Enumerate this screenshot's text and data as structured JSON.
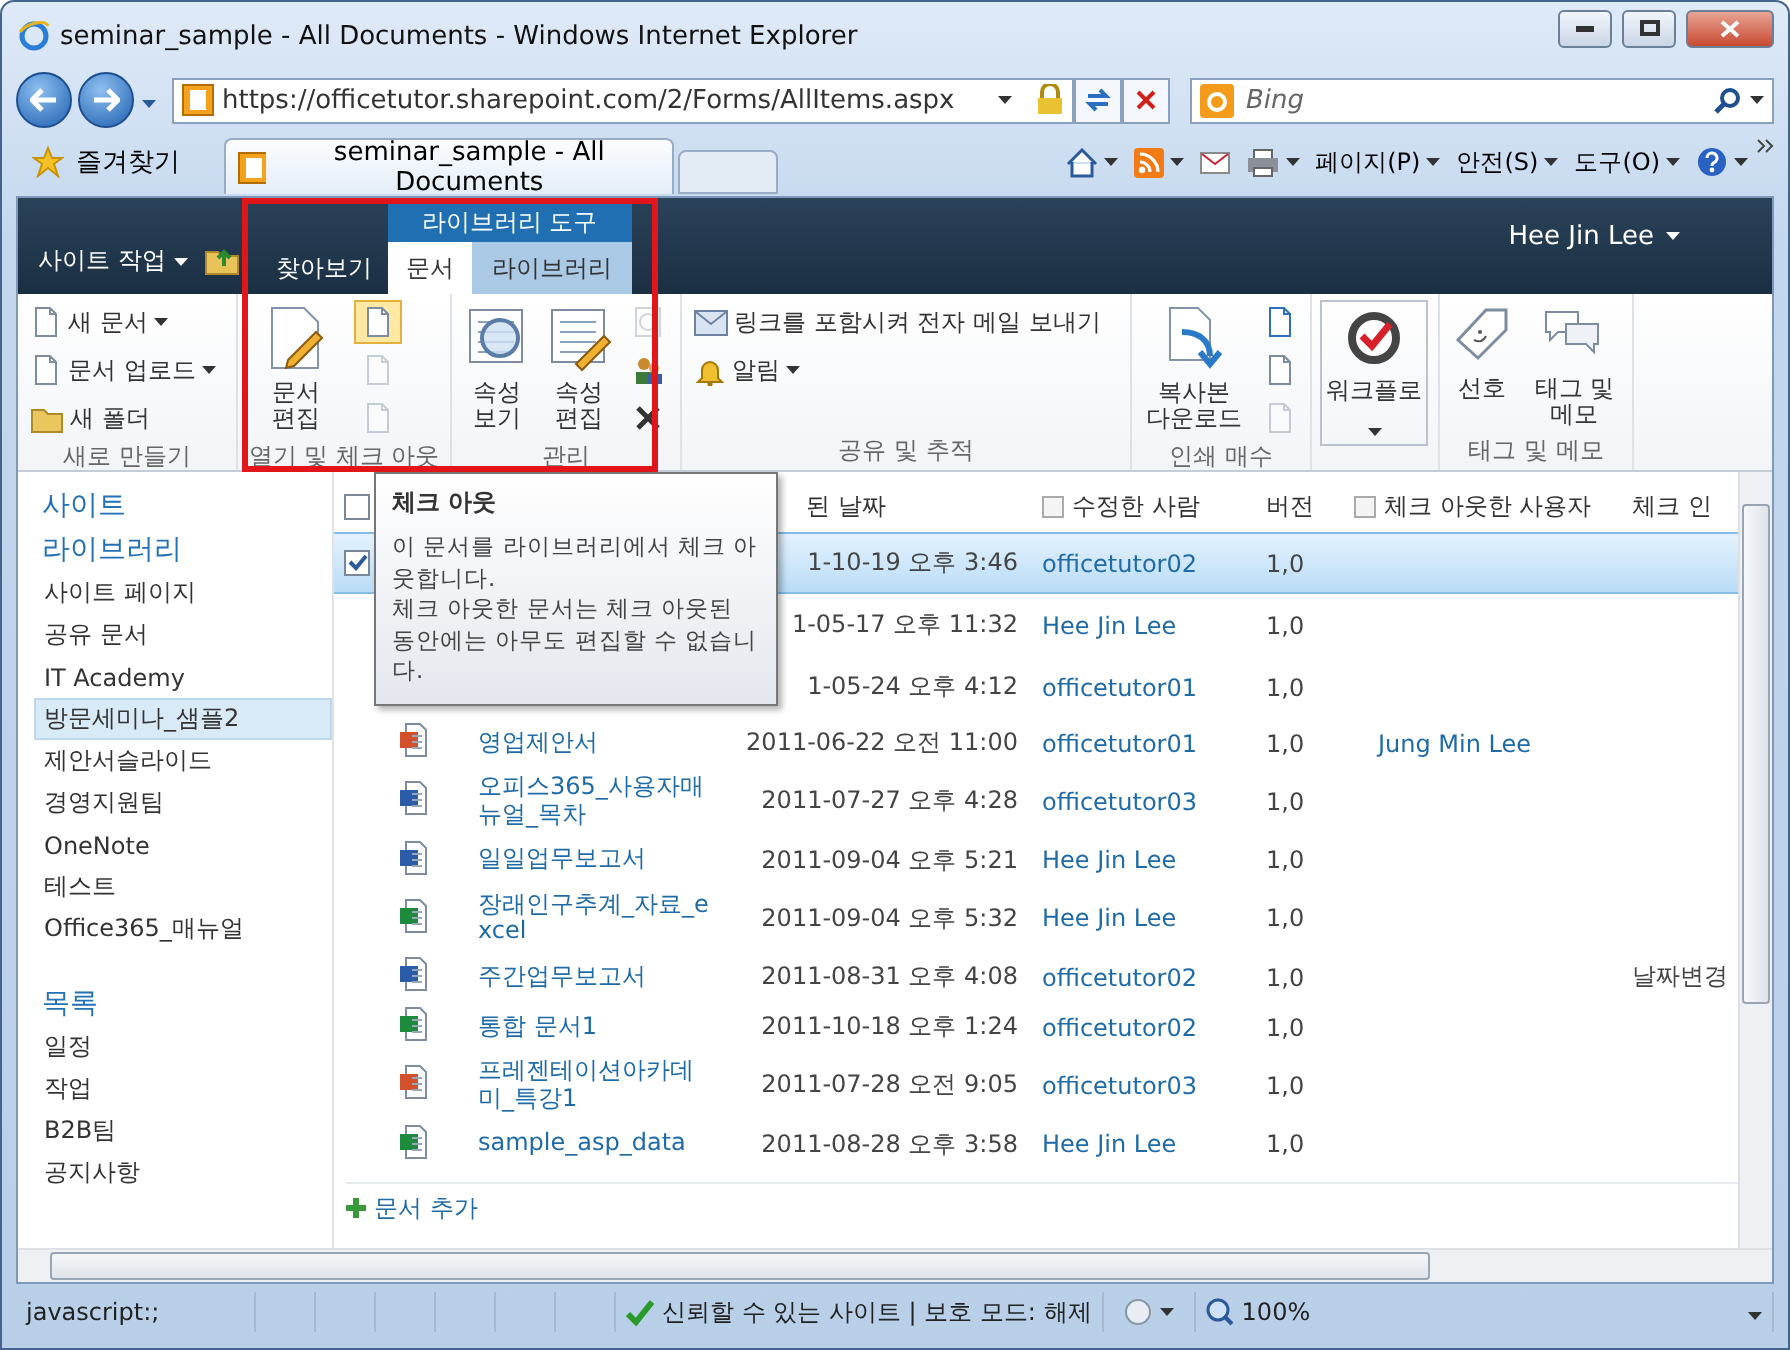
{
  "window": {
    "title": "seminar_sample - All Documents - Windows Internet Explorer"
  },
  "address_bar": {
    "url": "https://officetutor.sharepoint.com/2/Forms/AllItems.aspx"
  },
  "search": {
    "placeholder": "Bing"
  },
  "favorites_button": "즐겨찾기",
  "browser_tabs": [
    {
      "label": "seminar_sample - All Documents",
      "selected": true
    }
  ],
  "command_menus": [
    "페이지(P)",
    "안전(S)",
    "도구(O)"
  ],
  "site_header": {
    "site_actions": "사이트 작업",
    "context_group": "라이브러리 도구",
    "user": "Hee Jin Lee",
    "tabs": [
      {
        "label": "찾아보기",
        "selected": false
      },
      {
        "label": "문서",
        "selected": true
      },
      {
        "label": "라이브러리",
        "selected": false
      }
    ]
  },
  "ribbon": {
    "new": {
      "label": "새로 만들기",
      "buttons": [
        {
          "label": "새 문서",
          "dropdown": true
        },
        {
          "label": "문서 업로드",
          "dropdown": true
        },
        {
          "label": "새 폴더",
          "dropdown": false
        }
      ]
    },
    "open": {
      "label": "열기 및 체크 아웃",
      "edit": "문서 편집",
      "tools": [
        {
          "hovered": true,
          "disabled": false
        },
        {
          "hovered": false,
          "disabled": true
        },
        {
          "hovered": false,
          "disabled": true
        }
      ]
    },
    "manage": {
      "label": "관리",
      "buttons": [
        "속성 보기",
        "속성 편집"
      ],
      "tools": [
        {
          "disabled": true
        },
        {
          "disabled": false
        },
        {
          "disabled": false
        }
      ]
    },
    "share": {
      "label": "공유 및 추적",
      "buttons": [
        {
          "label": "링크를 포함시켜 전자 메일 보내기",
          "dropdown": false
        },
        {
          "label": "알림",
          "dropdown": true
        }
      ]
    },
    "copies": {
      "label": "인쇄 매수",
      "download": "복사본 다운로드",
      "tools": [
        {
          "disabled": false
        },
        {
          "disabled": false
        },
        {
          "disabled": true
        }
      ]
    },
    "workflow": {
      "button": "워크플로"
    },
    "tags": {
      "label": "태그 및 메모",
      "buttons": [
        "선호",
        "태그 및 메모"
      ]
    }
  },
  "nav": {
    "sections": [
      {
        "heading": "사이트"
      },
      {
        "heading": "라이브러리",
        "items": [
          {
            "label": "사이트 페이지",
            "selected": false
          },
          {
            "label": "공유 문서",
            "selected": false
          },
          {
            "label": "IT Academy",
            "selected": false
          },
          {
            "label": "방문세미나_샘플2",
            "selected": true
          },
          {
            "label": "제안서슬라이드",
            "selected": false
          },
          {
            "label": "경영지원팀",
            "selected": false
          },
          {
            "label": "OneNote",
            "selected": false
          },
          {
            "label": "테스트",
            "selected": false
          },
          {
            "label": "Office365_매뉴얼",
            "selected": false
          }
        ]
      },
      {
        "heading": "목록",
        "items": [
          {
            "label": "일정",
            "selected": false
          },
          {
            "label": "작업",
            "selected": false
          },
          {
            "label": "B2B팀",
            "selected": false
          },
          {
            "label": "공지사항",
            "selected": false
          }
        ]
      }
    ]
  },
  "table": {
    "header": {
      "select_all": false,
      "date": "된 날짜",
      "modified_by": "수정한 사람",
      "version": "버전",
      "checked_out_by": "체크 아웃한 사용자",
      "check_in": "체크 인"
    },
    "rows": [
      {
        "kind": "covered",
        "selected": true,
        "checked": true,
        "modified": "1-10-19 오후 3:46",
        "modified_by": "officetutor02",
        "version": "1,0"
      },
      {
        "kind": "covered",
        "selected": false,
        "checked": false,
        "modified": "1-05-17 오후 11:32",
        "modified_by": "Hee Jin Lee",
        "version": "1,0"
      },
      {
        "kind": "covered",
        "selected": false,
        "checked": false,
        "modified": "1-05-24 오후 4:12",
        "modified_by": "officetutor01",
        "version": "1,0"
      },
      {
        "kind": "ppt",
        "selected": false,
        "checked": false,
        "name": "영업제안서",
        "modified": "2011-06-22 오전 11:00",
        "modified_by": "officetutor01",
        "version": "1,0",
        "checked_out_by": "Jung Min Lee"
      },
      {
        "kind": "word",
        "selected": false,
        "checked": false,
        "name": "오피스365_사용자매뉴얼_목차",
        "modified": "2011-07-27 오후 4:28",
        "modified_by": "officetutor03",
        "version": "1,0"
      },
      {
        "kind": "word",
        "selected": false,
        "checked": false,
        "name": "일일업무보고서",
        "modified": "2011-09-04 오후 5:21",
        "modified_by": "Hee Jin Lee",
        "version": "1,0"
      },
      {
        "kind": "excel",
        "selected": false,
        "checked": false,
        "name": "장래인구추계_자료_excel",
        "modified": "2011-09-04 오후 5:32",
        "modified_by": "Hee Jin Lee",
        "version": "1,0"
      },
      {
        "kind": "word",
        "selected": false,
        "checked": false,
        "name": "주간업무보고서",
        "modified": "2011-08-31 오후 4:08",
        "modified_by": "officetutor02",
        "version": "1,0",
        "check_in": "날짜변경"
      },
      {
        "kind": "excel",
        "selected": false,
        "checked": false,
        "name": "통합 문서1",
        "modified": "2011-10-18 오후 1:24",
        "modified_by": "officetutor02",
        "version": "1,0"
      },
      {
        "kind": "ppt",
        "selected": false,
        "checked": false,
        "name": "프레젠테이션아카데미_특강1",
        "modified": "2011-07-28 오전 9:05",
        "modified_by": "officetutor03",
        "version": "1,0"
      },
      {
        "kind": "excel",
        "selected": false,
        "checked": false,
        "name": "sample_asp_data",
        "modified": "2011-08-28 오후 3:58",
        "modified_by": "Hee Jin Lee",
        "version": "1,0"
      }
    ],
    "add_document": "문서 추가"
  },
  "tooltip": {
    "title": "체크 아웃",
    "paragraphs": [
      "이 문서를 라이브러리에서 체크 아웃합니다.",
      "체크 아웃한 문서는 체크 아웃된 동안에는 아무도 편집할 수 없습니다."
    ]
  },
  "status_bar": {
    "text": "javascript:;",
    "zone": "신뢰할 수 있는 사이트 | 보호 모드: 해제",
    "zoom": "100%"
  }
}
